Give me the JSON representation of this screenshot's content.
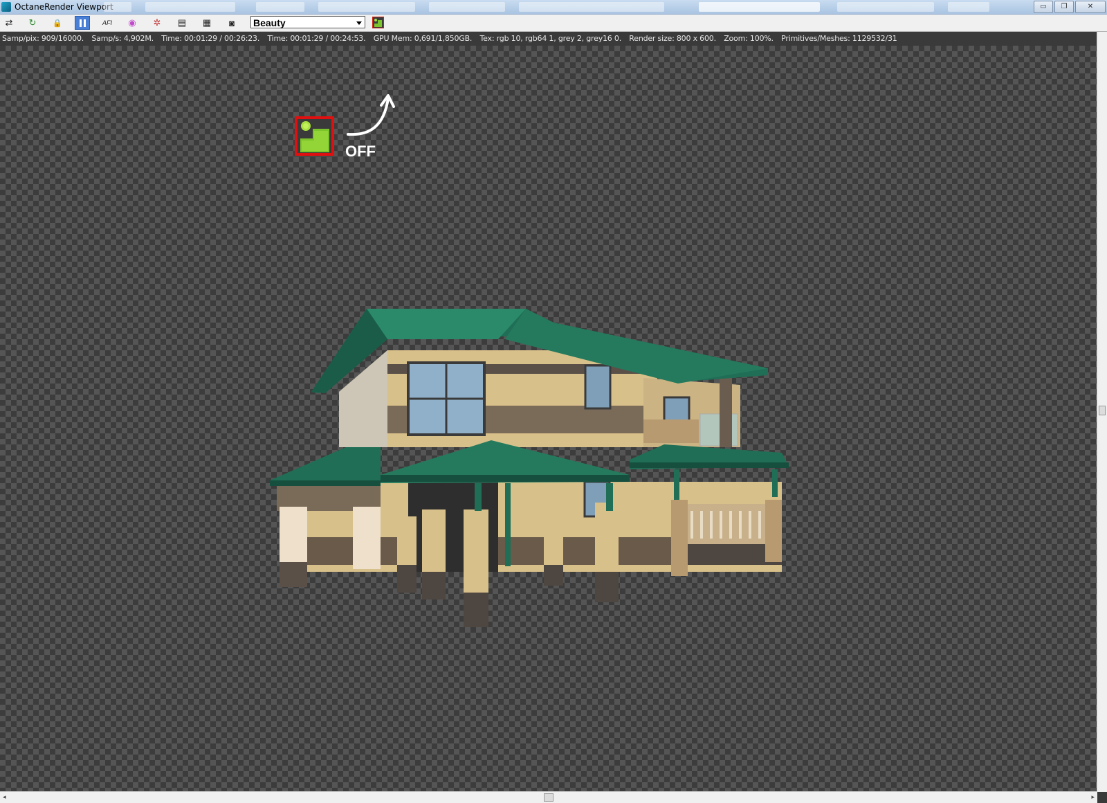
{
  "window": {
    "title": "OctaneRender Viewport",
    "controls": {
      "minimize": "▭",
      "restore": "❐",
      "close": "✕"
    }
  },
  "toolbar": {
    "buttons": [
      {
        "name": "send-scene-icon",
        "glyph": "⇄"
      },
      {
        "name": "restart-icon",
        "glyph": "↻"
      },
      {
        "name": "lock-icon",
        "glyph": "🔒"
      },
      {
        "name": "pause-icon",
        "glyph": ""
      },
      {
        "name": "af-icon",
        "glyph": "AFI"
      },
      {
        "name": "color-wheel-icon",
        "glyph": "◉"
      },
      {
        "name": "region-icon",
        "glyph": "✲"
      },
      {
        "name": "display-icon",
        "glyph": "▤"
      },
      {
        "name": "film-icon",
        "glyph": "▦"
      },
      {
        "name": "camera-icon",
        "glyph": "◙"
      }
    ],
    "render_pass": "Beauty"
  },
  "status": {
    "samp_pix": "Samp/pix: 909/16000.",
    "samp_s": "Samp/s: 4,902M.",
    "time1": "Time: 00:01:29 / 00:26:23.",
    "time2": "Time: 00:01:29 / 00:24:53.",
    "gpu_mem": "GPU Mem: 0,691/1,850GB.",
    "tex": "Tex: rgb 10, rgb64 1, grey 2, grey16 0.",
    "render_size": "Render size: 800 x 600.",
    "zoom": "Zoom: 100%.",
    "primitives": "Primitives/Meshes: 1129532/31"
  },
  "annotation": {
    "label": "OFF",
    "highlight_color": "#e01010"
  },
  "colors": {
    "roof": "#1f6e55",
    "brick": "#d8c08a",
    "stone": "#5a5048",
    "checker_dark": "#3c3c3c",
    "checker_light": "#555555"
  }
}
